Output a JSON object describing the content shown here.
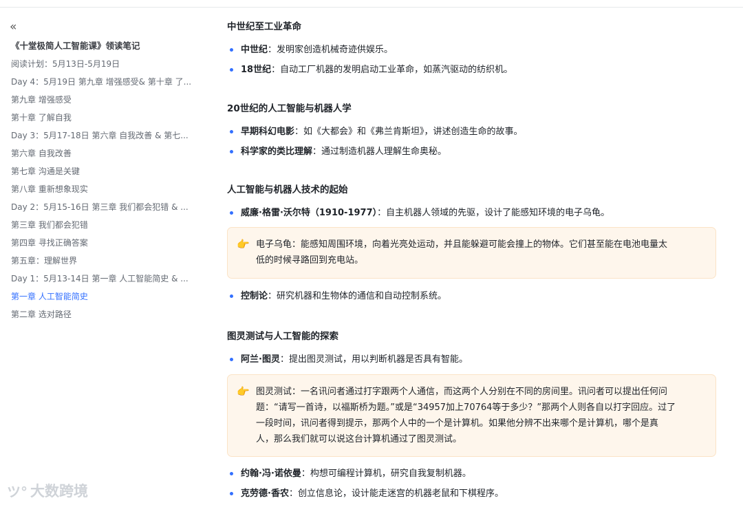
{
  "sidebar": {
    "collapse_icon": "«",
    "toc_title": "《十堂极简人工智能课》领读笔记",
    "items": [
      {
        "label": "阅读计划：5月13日-5月19日"
      },
      {
        "label": "Day 4：5月19日 第九章 增强感受& 第十章 了..."
      },
      {
        "label": "第九章 增强感受"
      },
      {
        "label": "第十章 了解自我"
      },
      {
        "label": "Day 3：5月17-18日 第六章 自我改善 & 第七..."
      },
      {
        "label": "第六章 自我改善"
      },
      {
        "label": "第七章 沟通是关键"
      },
      {
        "label": "第八章 重新想象现实"
      },
      {
        "label": "Day 2：5月15-16日 第三章 我们都会犯错 & ..."
      },
      {
        "label": "第三章 我们都会犯错"
      },
      {
        "label": "第四章 寻找正确答案"
      },
      {
        "label": "第五章：理解世界"
      },
      {
        "label": "Day 1：5月13-14日 第一章 人工智能简史 & ..."
      },
      {
        "label": "第一章 人工智能简史"
      },
      {
        "label": "第二章 选对路径"
      }
    ],
    "active_index": 13,
    "watermark": "大数跨境",
    "watermark_icon": "ツ°"
  },
  "main": {
    "s1": {
      "heading": "中世纪至工业革命",
      "b1_term": "中世纪",
      "b1_text": "：发明家创造机械奇迹供娱乐。",
      "b2_term": "18世纪",
      "b2_text": "：自动工厂机器的发明启动工业革命，如蒸汽驱动的纺织机。"
    },
    "s2": {
      "heading": "20世纪的人工智能与机器人学",
      "b1_term": "早期科幻电影",
      "b1_text": "：如《大都会》和《弗兰肯斯坦》，讲述创造生命的故事。",
      "b2_term": "科学家的类比理解",
      "b2_text": "：通过制造机器人理解生命奥秘。"
    },
    "s3": {
      "heading": "人工智能与机器人技术的起始",
      "b1_term": "威廉·格雷·沃尔特（1910-1977）",
      "b1_text": "：自主机器人领域的先驱，设计了能感知环境的电子乌龟。",
      "callout_line1": "电子乌龟：能感知周围环境，向着光亮处运动，并且能躲避可能会撞上的物体。它们甚至能在电池电量太",
      "callout_line2": "低的时候寻路回到充电站。",
      "b2_term": "控制论",
      "b2_text": "：研究机器和生物体的通信和自动控制系统。"
    },
    "s4": {
      "heading": "图灵测试与人工智能的探索",
      "b1_term": "阿兰·图灵",
      "b1_text": "：提出图灵测试，用以判断机器是否具有智能。",
      "callout_line1": "图灵测试：一名讯问者通过打字跟两个人通信，而这两个人分别在不同的房间里。讯问者可以提出任何问",
      "callout_line2": "题：“请写一首诗，以福斯桥为题。”或是“34957加上70764等于多少？”那两个人则各自以打字回应。过了",
      "callout_line3": "一段时间，讯问者得到提示，那两个人中的一个是计算机。如果他分辨不出来哪个是计算机，哪个是真",
      "callout_line4": "人，那么我们就可以说这台计算机通过了图灵测试。",
      "b2_term": "约翰·冯·诺依曼",
      "b2_text": "：构想可编程计算机，研究自我复制机器。",
      "b3_term": "克劳德·香农",
      "b3_text": "：创立信息论，设计能走迷宫的机器老鼠和下棋程序。"
    },
    "callout_icon": "👉"
  }
}
